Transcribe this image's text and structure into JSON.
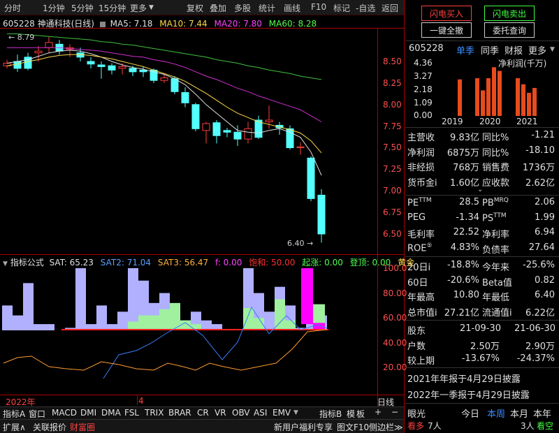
{
  "toolbar_left": [
    "分时",
    "1分钟",
    "5分钟",
    "15分钟",
    "更多"
  ],
  "toolbar_right": [
    "复权",
    "叠加",
    "多股",
    "统计",
    "画线",
    "F10",
    "标记",
    "-自选",
    "返回"
  ],
  "stock": {
    "title": "605228 神通科技(日线)"
  },
  "ma": {
    "ma5": "MA5: 7.18",
    "ma10": "MA10: 7.44",
    "ma20": "MA20: 7.80",
    "ma60": "MA60: 8.28"
  },
  "price_axis": [
    "8.50",
    "8.25",
    "8.00",
    "7.75",
    "7.50",
    "7.25",
    "7.00",
    "6.75",
    "6.50"
  ],
  "price_marks": {
    "high": "8.79",
    "low": "6.40"
  },
  "indicator": {
    "menu": "指标公式",
    "sat": "SAT: 65.23",
    "sat2": "SAT2: 71.04",
    "sat3": "SAT3: 56.47",
    "f": "f: 0.00",
    "baohe": "饱和: 50.00",
    "qizhang": "起涨: 0.00",
    "dengding": "登顶: 0.00",
    "huangjin": "黄金"
  },
  "ind_axis": [
    "100.0",
    "80.00",
    "60.00",
    "40.00",
    "20.00"
  ],
  "date_axis": {
    "year": "2022年",
    "month": "4",
    "mode": "日线"
  },
  "ind_tabs": [
    "指标A",
    "窗口",
    "MACD",
    "DMI",
    "DMA",
    "FSL",
    "TRIX",
    "BRAR",
    "CR",
    "VR",
    "OBV",
    "ASI",
    "EMV"
  ],
  "ind_tabs_right": [
    "指标B",
    "模",
    "板",
    "+",
    "−"
  ],
  "bottom": {
    "expand": "扩展∧",
    "related": "关联报价",
    "wealth": "财富圈",
    "promo": "新用户福利专享",
    "f10": "图文F10",
    "side": "侧边栏≫"
  },
  "trade": {
    "buy": "闪电买入",
    "sell": "闪电卖出",
    "cancel": "一键全撤",
    "query": "委托查询"
  },
  "fin": {
    "code": "605228",
    "tab1": "单季",
    "tab2": "同季",
    "tab3": "财报",
    "tab4": "更多",
    "chart_title": "净利润(千万)",
    "yticks": [
      "4.36",
      "3.27",
      "2.18",
      "1.09",
      "0.00"
    ],
    "years": [
      "2019",
      "2020",
      "2021"
    ]
  },
  "chart_data": {
    "type": "bar",
    "title": "净利润(千万)",
    "categories": [
      "2019Q3",
      "2019Q4",
      "2020Q1",
      "2020Q2",
      "2020Q3",
      "2020Q4",
      "2021Q1",
      "2021Q2",
      "2021Q3",
      "2021Q4"
    ],
    "values": [
      3.0,
      3.1,
      2.1,
      3.1,
      4.0,
      3.7,
      3.1,
      2.6,
      1.9,
      2.3
    ],
    "ylim": [
      0,
      4.36
    ],
    "color": "#e84b1c"
  },
  "stats1": [
    {
      "k": "主营收",
      "v": "9.83亿",
      "k2": "同比%",
      "v2": "-1.21"
    },
    {
      "k": "净利润",
      "v": "6875万",
      "k2": "同比%",
      "v2": "-18.10"
    },
    {
      "k": "非经损",
      "v": "768万",
      "k2": "销售费",
      "v2": "1736万"
    },
    {
      "k": "货币金i",
      "v": "1.60亿",
      "k2": "应收款",
      "v2": "2.62亿"
    }
  ],
  "stats2": [
    {
      "k": "PE",
      "sup": "TTM",
      "v": "28.5",
      "k2": "PB",
      "sup2": "MRQ",
      "v2": "2.06"
    },
    {
      "k": "PEG",
      "sup": "",
      "v": "-1.34",
      "k2": "PS",
      "sup2": "TTM",
      "v2": "1.99"
    },
    {
      "k": "毛利率",
      "sup": "",
      "v": "22.52",
      "k2": "净利率",
      "sup2": "",
      "v2": "6.94"
    },
    {
      "k": "ROE",
      "sup": "⑤",
      "v": "4.83%",
      "k2": "负债率",
      "sup2": "",
      "v2": "27.64"
    }
  ],
  "stats3": [
    {
      "k": "20日i",
      "v": "-18.8%",
      "k2": "今年来",
      "v2": "-25.6%"
    },
    {
      "k": "60日",
      "v": "-20.6%",
      "k2": "Beta值",
      "v2": "0.82"
    },
    {
      "k": "年最高",
      "v": "10.80",
      "k2": "年最低",
      "v2": "6.40"
    },
    {
      "k": "总市值i",
      "v": "27.21亿",
      "k2": "流通值i",
      "v2": "6.22亿"
    }
  ],
  "holders": {
    "r1": {
      "k": "股东",
      "v": "21-09-30",
      "v2": "21-06-30"
    },
    "r2": {
      "k": "户数",
      "v": "2.50万",
      "v2": "2.90万"
    },
    "r3": {
      "k": "较上期",
      "v": "-13.67%",
      "v2": "-24.37%"
    }
  },
  "notices": [
    "2021年年报于4月29日披露",
    "2022年一季报于4月29日披露"
  ],
  "eyes": {
    "label": "眼光",
    "t1": "今日",
    "t2": "本周",
    "t3": "本月",
    "t4": "本年",
    "kan1": "看多",
    "n1": "7人",
    "n2": "3人",
    "kan2": "看空"
  }
}
